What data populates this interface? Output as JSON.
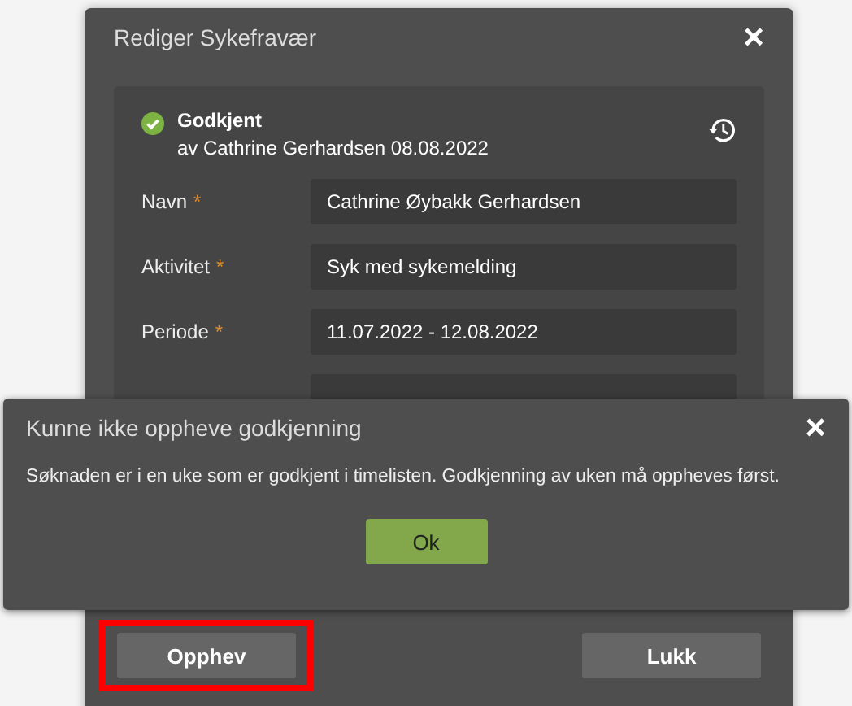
{
  "dialog": {
    "title": "Rediger Sykefravær",
    "close": "×",
    "status": {
      "label": "Godkjent",
      "detail": "av Cathrine Gerhardsen 08.08.2022"
    },
    "fields": [
      {
        "label": "Navn",
        "marker": "*",
        "value": "Cathrine Øybakk Gerhardsen"
      },
      {
        "label": "Aktivitet",
        "marker": "*",
        "value": "Syk med sykemelding"
      },
      {
        "label": "Periode",
        "marker": "*",
        "value": "11.07.2022 - 12.08.2022"
      }
    ],
    "buttons": [
      {
        "label": "Opphev",
        "highlighted": true
      },
      {
        "label": "Lukk",
        "highlighted": false
      }
    ]
  },
  "alert": {
    "title": "Kunne ikke oppheve godkjenning",
    "close": "×",
    "message": "Søknaden er i en uke som er godkjent i timelisten. Godkjenning av uken må oppheves først.",
    "button": "Ok"
  }
}
